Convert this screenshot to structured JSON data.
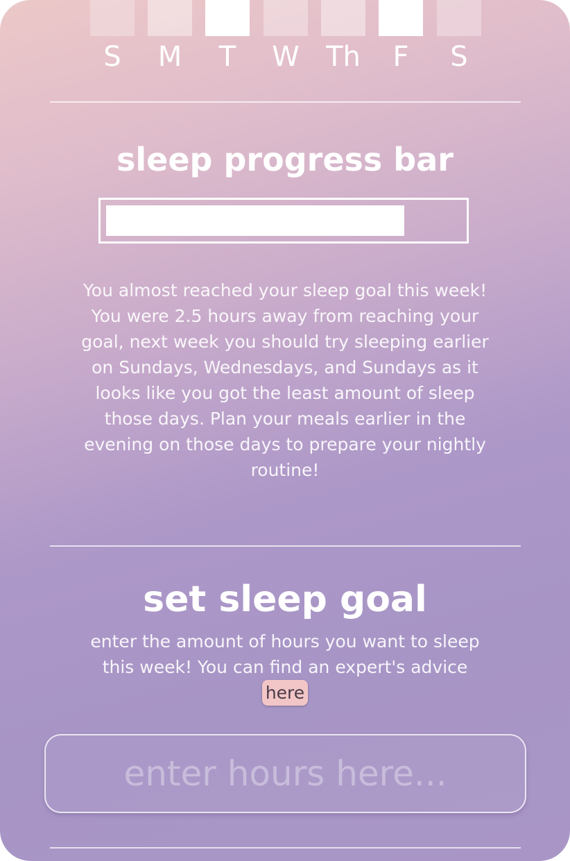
{
  "week": {
    "days": [
      {
        "label": "S"
      },
      {
        "label": "M"
      },
      {
        "label": "T"
      },
      {
        "label": "W"
      },
      {
        "label": "Th"
      },
      {
        "label": "F"
      },
      {
        "label": "S"
      }
    ]
  },
  "progress": {
    "title": "sleep progress bar",
    "fraction": 0.84,
    "message": "You almost reached your sleep goal this week! You were 2.5 hours away from reaching your goal, next week you should try sleeping earlier on Sundays, Wednesdays, and Sundays as it looks like you got the least amount of sleep those days. Plan your meals earlier in the evening on those days to prepare your nightly routine!"
  },
  "goal": {
    "title": "set sleep goal",
    "description": "enter the amount of hours you want to sleep this week! You can find  an expert's advice",
    "link_label": "here",
    "input_placeholder": "enter hours here..."
  },
  "colors": {
    "link_chip": "#f2c6c6",
    "gradient_top": "#ecc8c8",
    "gradient_bottom": "#a996c6"
  }
}
